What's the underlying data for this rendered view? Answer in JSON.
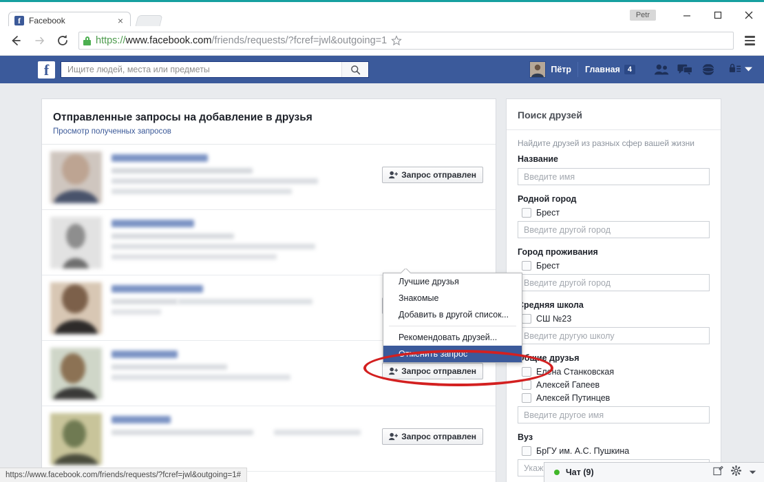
{
  "window": {
    "user_chip": "Petr",
    "minimize_label": "Minimize",
    "maximize_label": "Maximize",
    "close_label": "Close"
  },
  "browser": {
    "tab": {
      "title": "Facebook",
      "favicon_letter": "f",
      "close_label": "×"
    },
    "url": {
      "scheme": "https://",
      "host": "www.facebook.com",
      "path": "/friends/requests/?fcref=jwl&outgoing=1"
    },
    "status_url": "https://www.facebook.com/friends/requests/?fcref=jwl&outgoing=1#"
  },
  "fbbar": {
    "logo_letter": "f",
    "search_placeholder": "Ищите людей, места или предметы",
    "profile_name": "Пётр",
    "home_label": "Главная",
    "home_badge": "4",
    "accent": "#3b5a9b"
  },
  "main": {
    "title": "Отправленные запросы на добавление в друзья",
    "subtitle_link": "Просмотр полученных запросов",
    "request_button_label": "Запрос отправлен",
    "rows": [
      {
        "avatar_tint": "#8e7f78"
      },
      {
        "avatar_tint": "#9a9a9a"
      },
      {
        "avatar_tint": "#8a7162"
      },
      {
        "avatar_tint": "#9c8b7a"
      },
      {
        "avatar_tint": "#8d8f78"
      }
    ]
  },
  "dropdown": {
    "items": [
      {
        "label": "Лучшие друзья",
        "selected": false,
        "separator_after": false
      },
      {
        "label": "Знакомые",
        "selected": false,
        "separator_after": false
      },
      {
        "label": "Добавить в другой список...",
        "selected": false,
        "separator_after": true
      },
      {
        "label": "Рекомендовать друзей...",
        "selected": false,
        "separator_after": false
      },
      {
        "label": "Отменить запрос",
        "selected": true,
        "separator_after": false
      }
    ],
    "highlight_color": "#3b5a9b",
    "annotation_color": "#d32020"
  },
  "sidebar": {
    "title": "Поиск друзей",
    "description": "Найдите друзей из разных сфер вашей жизни",
    "groups": [
      {
        "label": "Название",
        "checkboxes": [],
        "input_placeholder": "Введите имя"
      },
      {
        "label": "Родной город",
        "checkboxes": [
          "Брест"
        ],
        "input_placeholder": "Введите другой город"
      },
      {
        "label": "Город проживания",
        "checkboxes": [
          "Брест"
        ],
        "input_placeholder": "Введите другой город"
      },
      {
        "label": "Средняя школа",
        "checkboxes": [
          "СШ №23"
        ],
        "input_placeholder": "Введите другую школу"
      },
      {
        "label": "Общие друзья",
        "checkboxes": [
          "Елена Станковская",
          "Алексей Гапеев",
          "Алексей Путинцев"
        ],
        "input_placeholder": "Введите другое имя"
      },
      {
        "label": "Вуз",
        "checkboxes": [
          "БрГУ им. А.С. Пушкина"
        ],
        "input_placeholder": "Укажите другой вуз"
      }
    ]
  },
  "chat": {
    "label": "Чат (9)",
    "online_color": "#42b72a"
  }
}
